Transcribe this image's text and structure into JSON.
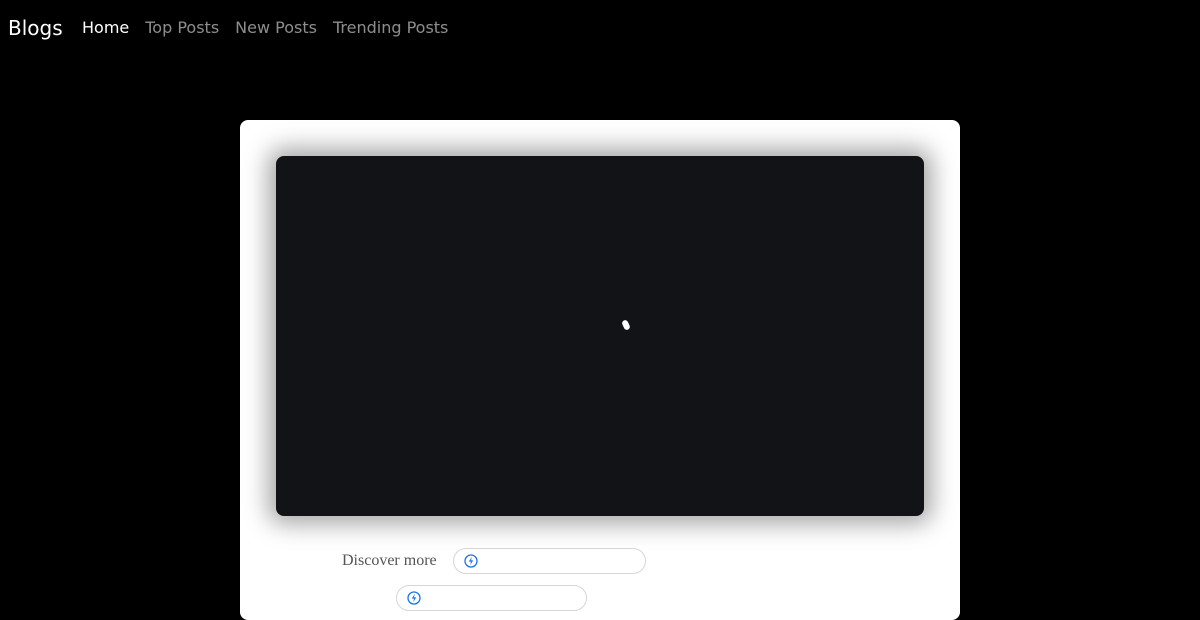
{
  "navbar": {
    "brand": "Blogs",
    "links": [
      {
        "label": "Home",
        "active": true
      },
      {
        "label": "Top Posts",
        "active": false
      },
      {
        "label": "New Posts",
        "active": false
      },
      {
        "label": "Trending Posts",
        "active": false
      }
    ]
  },
  "content": {
    "discover_label": "Discover more"
  },
  "icons": {
    "bolt": "bolt-icon",
    "spinner": "loading-spinner-icon"
  },
  "colors": {
    "background": "#000000",
    "card": "#ffffff",
    "player": "#121317",
    "icon_blue": "#1a73e8"
  }
}
